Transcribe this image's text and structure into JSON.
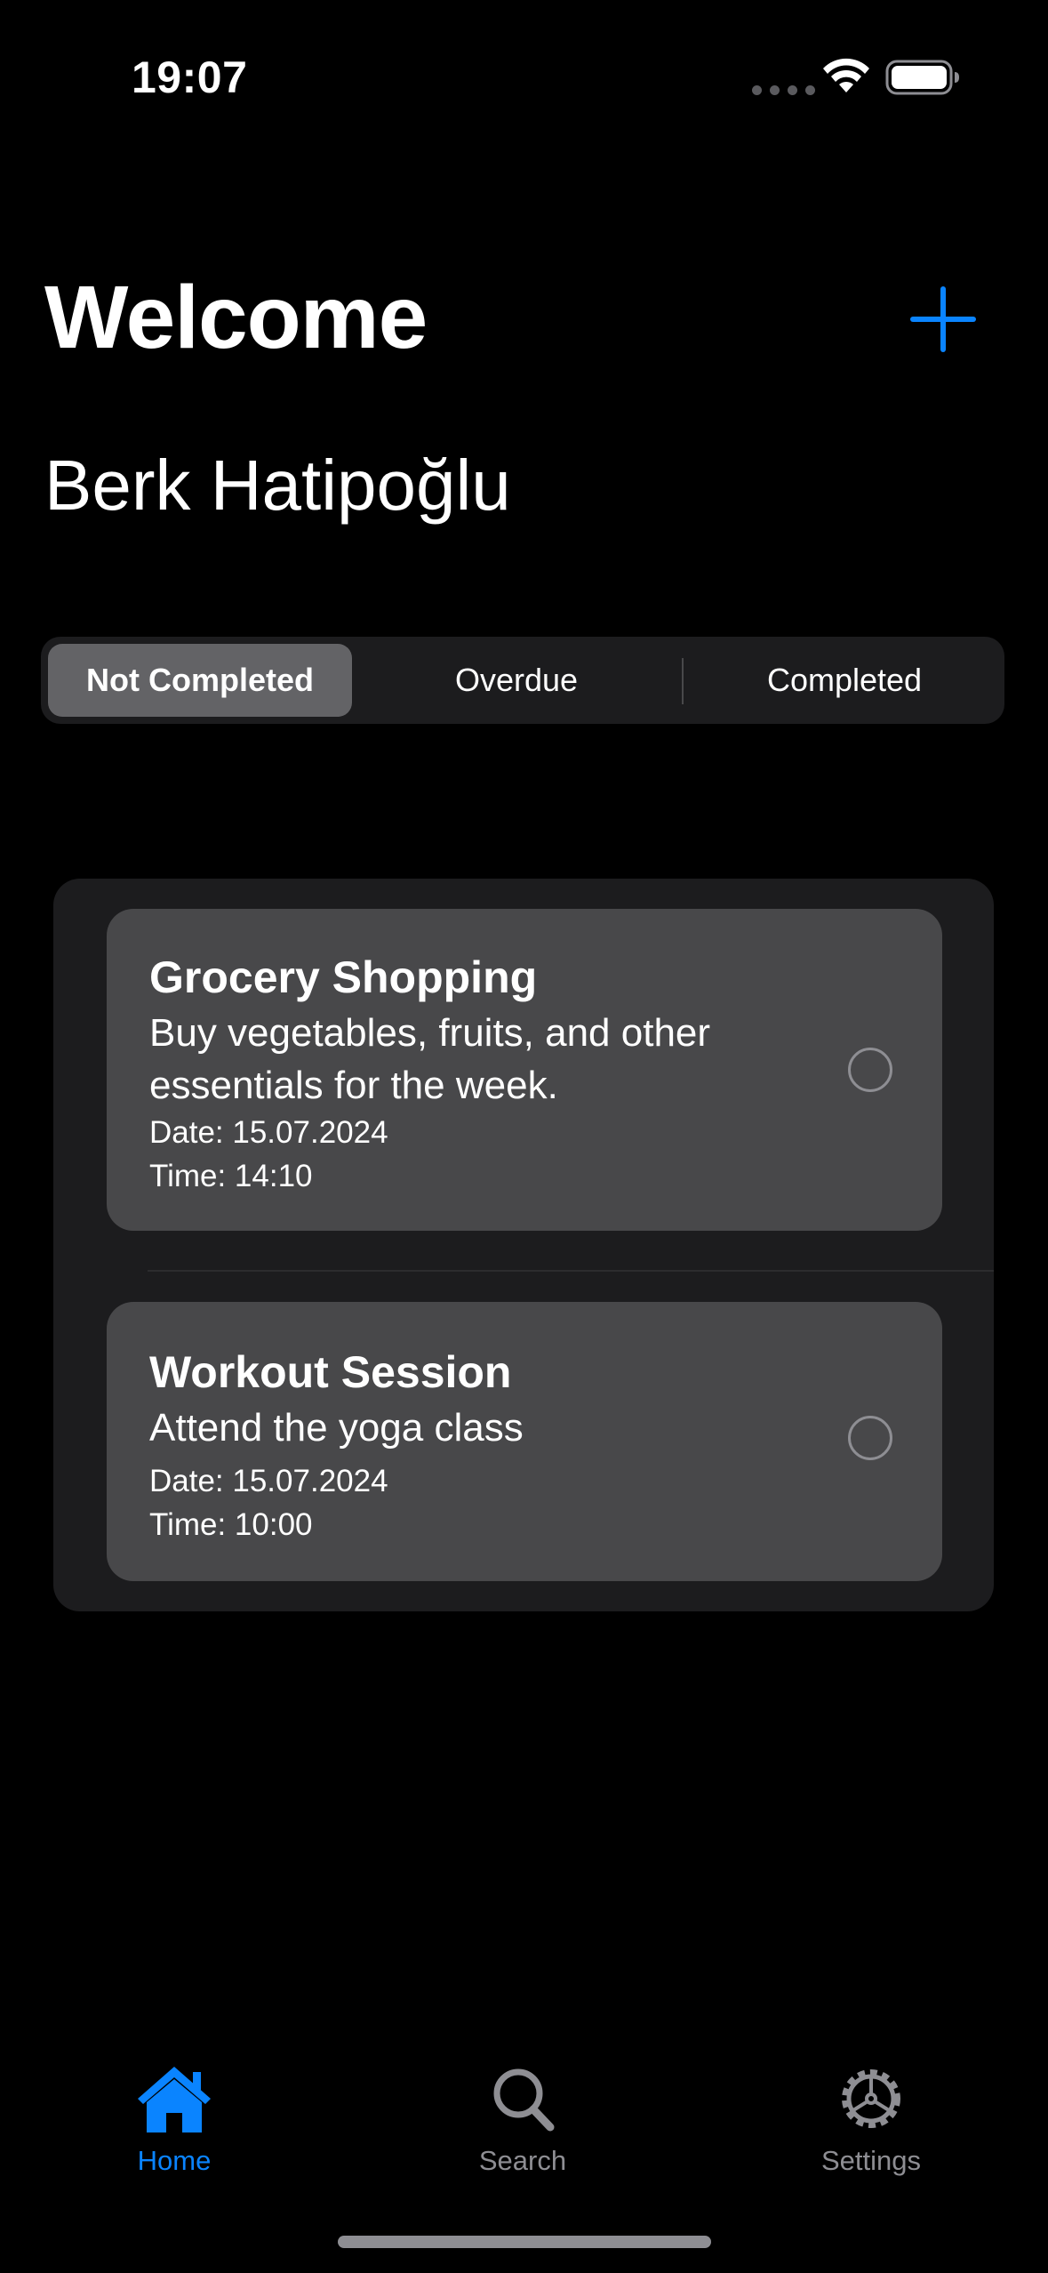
{
  "status_bar": {
    "time": "19:07",
    "signal_icon": "cellular-dots-icon",
    "wifi_icon": "wifi-icon",
    "battery_icon": "battery-full-icon"
  },
  "header": {
    "title": "Welcome",
    "user_name": "Berk Hatipoğlu",
    "add_icon": "plus-icon"
  },
  "segmented_control": {
    "items": [
      {
        "label": "Not Completed",
        "selected": true
      },
      {
        "label": "Overdue",
        "selected": false
      },
      {
        "label": "Completed",
        "selected": false
      }
    ]
  },
  "tasks": [
    {
      "title": "Grocery Shopping",
      "description": "Buy vegetables, fruits, and other essentials for the week.",
      "date": "Date: 15.07.2024",
      "time": "Time: 14:10",
      "completed": false
    },
    {
      "title": "Workout Session",
      "description": "Attend the yoga class",
      "date": "Date: 15.07.2024",
      "time": "Time: 10:00",
      "completed": false
    }
  ],
  "tab_bar": {
    "items": [
      {
        "label": "Home",
        "icon": "house-icon",
        "active": true
      },
      {
        "label": "Search",
        "icon": "magnifier-icon",
        "active": false
      },
      {
        "label": "Settings",
        "icon": "gear-icon",
        "active": false
      }
    ]
  },
  "colors": {
    "accent": "#0a84ff",
    "background": "#000000",
    "card": "#48484a",
    "container": "#1c1c1e",
    "inactive_tab": "#8e8e93"
  }
}
